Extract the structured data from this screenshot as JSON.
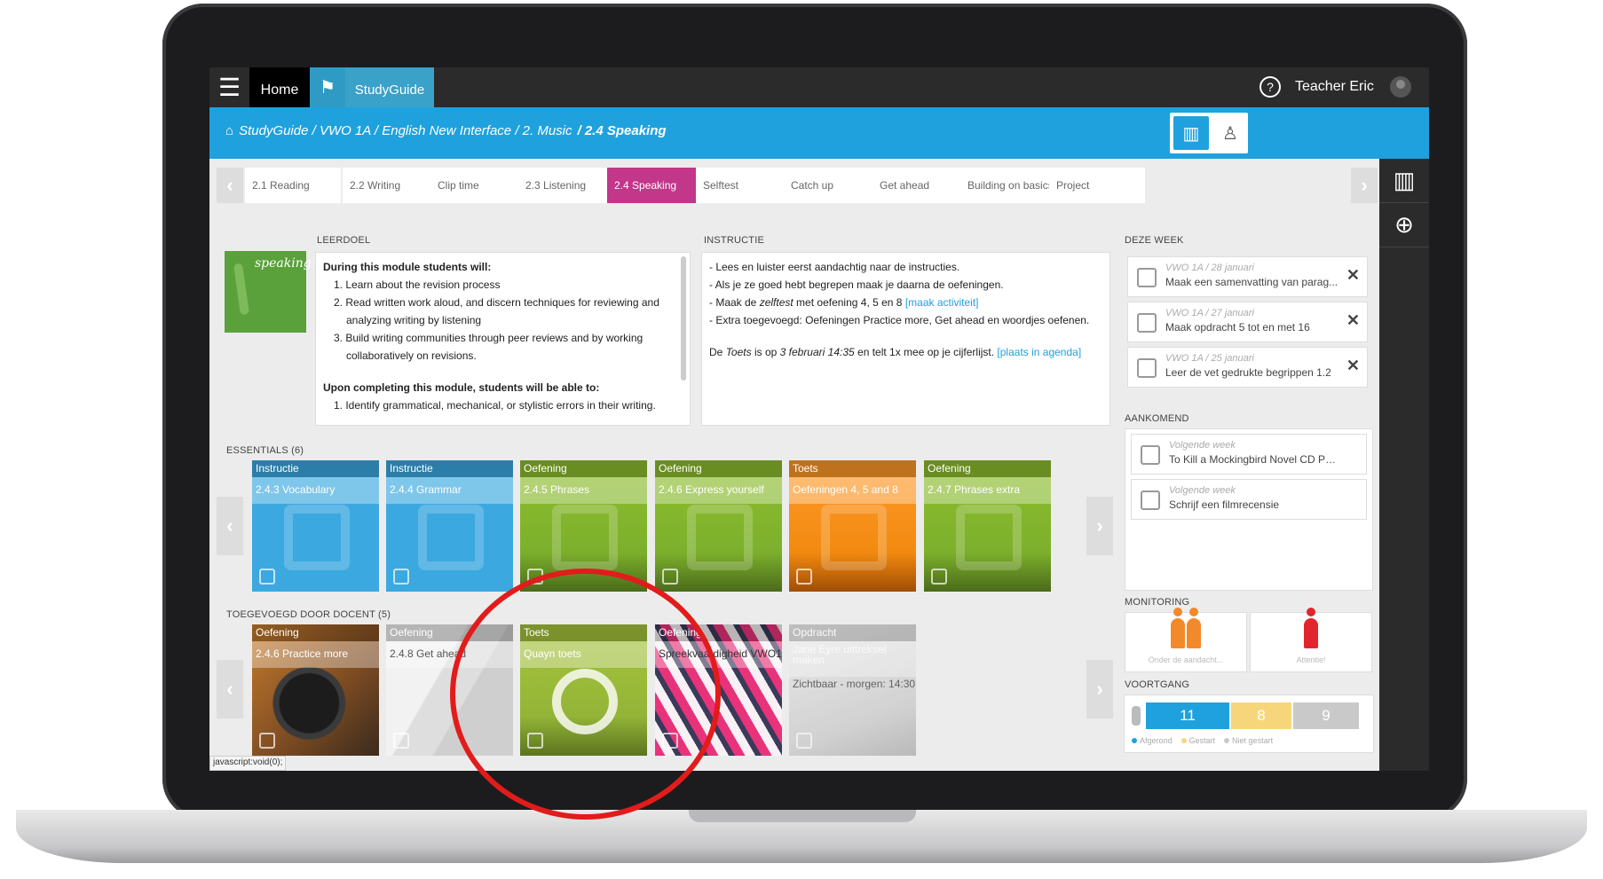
{
  "topbar": {
    "home": "Home",
    "studyguide": "StudyGuide",
    "user": "Teacher Eric",
    "help": "?"
  },
  "breadcrumb": {
    "path": "StudyGuide / VWO 1A / English New Interface / 2. Music",
    "current": "/ 2.4 Speaking"
  },
  "tabs": [
    "2.1 Reading",
    "2.2 Writing",
    "Clip time",
    "2.3 Listening",
    "2.4 Speaking",
    "Selftest",
    "Catch up",
    "Get ahead",
    "Building on basics",
    "Project"
  ],
  "leerdoel": {
    "label": "LEERDOEL",
    "image_text": "speaking",
    "heading1": "During this module students will:",
    "items1": [
      "1. Learn about the revision process",
      "2. Read written work aloud, and discern techniques for reviewing and analyzing writing by listening",
      "3. Build writing communities through peer reviews and by working collaboratively on revisions."
    ],
    "heading2": "Upon completing this module, students will be able to:",
    "items2": [
      "1. Identify grammatical, mechanical, or stylistic errors in their writing."
    ]
  },
  "instructie": {
    "label": "INSTRUCTIE",
    "l1": "- Lees en luister eerst aandachtig naar de instructies.",
    "l2": "- Als je ze goed hebt begrepen maak je daarna de oefeningen.",
    "l3a": "- Maak de ",
    "l3b": "zelftest",
    "l3c": " met oefening 4, 5 en 8 ",
    "l3link": "[maak activiteit]",
    "l4": "- Extra toegevoegd: Oefeningen Practice more, Get ahead en woordjes oefenen.",
    "l5a": "De ",
    "l5b": "Toets",
    "l5c": " is op ",
    "l5d": "3 februari 14:35",
    "l5e": " en telt 1x mee op je cijferlijst. ",
    "l5link": "[plaats in agenda]"
  },
  "deze_week": {
    "label": "DEZE WEEK",
    "items": [
      {
        "meta": "VWO 1A / 28 januari",
        "title": "Maak een samenvatting van parag..."
      },
      {
        "meta": "VWO 1A / 27 januari",
        "title": "Maak opdracht 5 tot en met 16"
      },
      {
        "meta": "VWO 1A / 25 januari",
        "title": "Leer de vet gedrukte begrippen 1.2"
      }
    ]
  },
  "aankomend": {
    "label": "AANKOMEND",
    "items": [
      {
        "meta": "Volgende week",
        "title": "To Kill a Mockingbird Novel CD Project..."
      },
      {
        "meta": "Volgende week",
        "title": "Schrijf een filmrecensie"
      }
    ]
  },
  "essentials": {
    "label": "ESSENTIALS (6)",
    "tiles": [
      {
        "type": "Instructie",
        "title": "2.4.3 Vocabulary"
      },
      {
        "type": "Instructie",
        "title": "2.4.4 Grammar"
      },
      {
        "type": "Oefening",
        "title": "2.4.5 Phrases"
      },
      {
        "type": "Oefening",
        "title": "2.4.6 Express yourself"
      },
      {
        "type": "Toets",
        "title": "Oefeningen 4, 5 and 8"
      },
      {
        "type": "Oefening",
        "title": "2.4.7 Phrases extra"
      }
    ]
  },
  "toegevoegd": {
    "label": "TOEGEVOEGD DOOR DOCENT (5)",
    "tiles": [
      {
        "type": "Oefening",
        "title": "2.4.6 Practice more"
      },
      {
        "type": "Oefening",
        "title": "2.4.8 Get ahead"
      },
      {
        "type": "Toets",
        "title": "Quayn toets"
      },
      {
        "type": "Oefening",
        "title": "Spreekvaardigheid VWO1"
      },
      {
        "type": "Opdracht",
        "title": "Jane Eyre uittreksel maken",
        "extra": "Zichtbaar - morgen: 14:30"
      }
    ]
  },
  "monitoring": {
    "label": "MONITORING",
    "a": "Onder de aandacht...",
    "b": "Attentie!"
  },
  "voortgang": {
    "label": "VOORTGANG",
    "afgerond": 11,
    "gestart": 8,
    "niet_gestart": 9,
    "l1": "Afgerond",
    "l2": "Gestart",
    "l3": "Niet gestart"
  },
  "status_text": "javascript:void(0);",
  "colors": {
    "accent": "#1fa1de",
    "active_tab": "#c2378a",
    "annotation": "#e21b1b"
  }
}
